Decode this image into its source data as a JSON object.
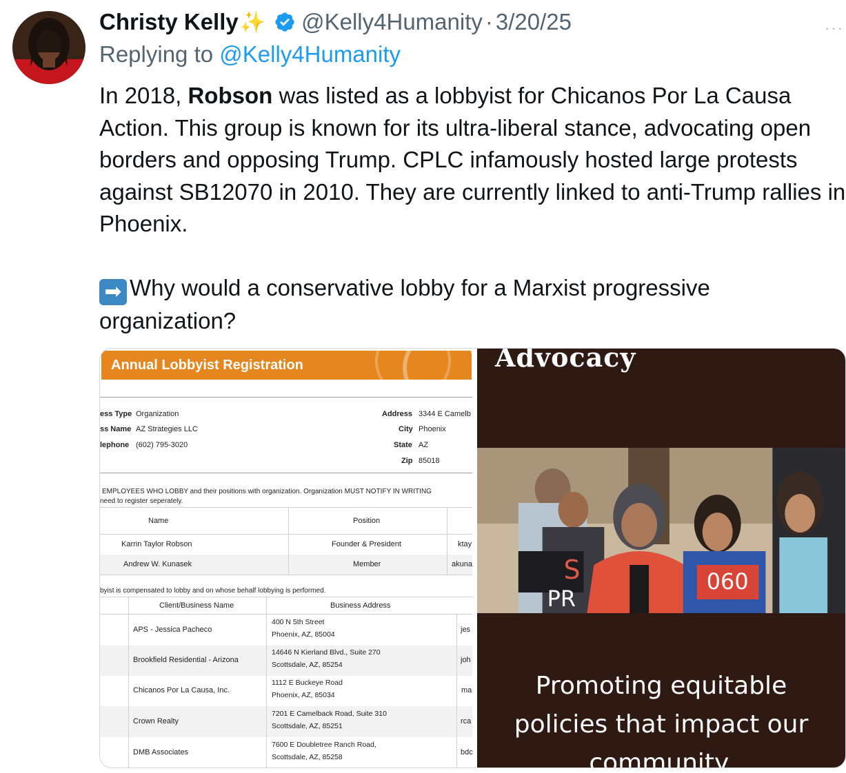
{
  "author": {
    "name": "Christy Kelly",
    "sparkle": "✨",
    "handle": "@Kelly4Humanity",
    "separator": "·",
    "date": "3/20/25"
  },
  "more_menu": "···",
  "replying": {
    "prefix": "Replying to ",
    "mention": "@Kelly4Humanity"
  },
  "tweet": {
    "p1_before": "In 2018, ",
    "p1_bold": "Robson",
    "p1_after": " was listed as a lobbyist for Chicanos Por La Causa Action. This group is known for its ultra-liberal stance, advocating open borders and opposing Trump. CPLC infamously hosted large protests against SB12070 in 2010.  They are currently linked to anti-Trump rallies in Phoenix.",
    "arrow_emoji": "➡",
    "p2": "Why would a conservative lobby for a Marxist progressive organization?"
  },
  "document": {
    "banner": "Annual Lobbyist Registration",
    "business_type_label": "ess Type",
    "business_type": "Organization",
    "business_name_label": "ss Name",
    "business_name": "AZ Strategies LLC",
    "telephone_label": "lephone",
    "telephone": "(602) 795-3020",
    "address_label": "Address",
    "address": "3344 E Camelb",
    "city_label": "City",
    "city": "Phoenix",
    "state_label": "State",
    "state": "AZ",
    "zip_label": "Zip",
    "zip": "85018",
    "employees_note_1": "EMPLOYEES WHO LOBBY and their positions with organization. Organization MUST NOTIFY IN WRITING",
    "employees_note_2": "need to register seperately.",
    "emp_headers": {
      "name": "Name",
      "position": "Position"
    },
    "employees": [
      {
        "name": "Karrin Taylor Robson",
        "position": "Founder & President",
        "email": "ktay"
      },
      {
        "name": "Andrew W. Kunasek",
        "position": "Member",
        "email": "akuna"
      }
    ],
    "clients_note": "byist is compensated to lobby and on whose behalf lobbying is performed.",
    "client_headers": {
      "name": "Client/Business Name",
      "address": "Business Address"
    },
    "clients": [
      {
        "name": "APS - Jessica Pacheco",
        "addr1": "400 N 5th Street",
        "addr2": "Phoenix, AZ, 85004",
        "email": "jes"
      },
      {
        "name": "Brookfield Residential - Arizona",
        "addr1": "14646 N Kierland Blvd., Suite 270",
        "addr2": "Scottsdale, AZ, 85254",
        "email": "joh"
      },
      {
        "name": "Chicanos Por La Causa, Inc.",
        "addr1": "1112 E Buckeye Road",
        "addr2": "Phoenix, AZ, 85034",
        "email": "ma"
      },
      {
        "name": "Crown Realty",
        "addr1": "7201 E Camelback Road, Suite 310",
        "addr2": "Scottsdale, AZ, 85251",
        "email": "rca"
      },
      {
        "name": "DMB Associates",
        "addr1": "7600 E Doubletree Ranch Road,",
        "addr2": "Scottsdale, AZ, 85258",
        "email": "bdc"
      }
    ]
  },
  "promo": {
    "title": "Advocacy",
    "sign_left": "S",
    "sign_left2": "PR",
    "sign_right": "060",
    "line1": "Promoting equitable",
    "line2": "policies that impact our",
    "line3": "community."
  },
  "colors": {
    "link": "#1d9bf0",
    "muted": "#536471",
    "banner_orange": "#e5861f",
    "promo_bg": "#2e1a12"
  }
}
